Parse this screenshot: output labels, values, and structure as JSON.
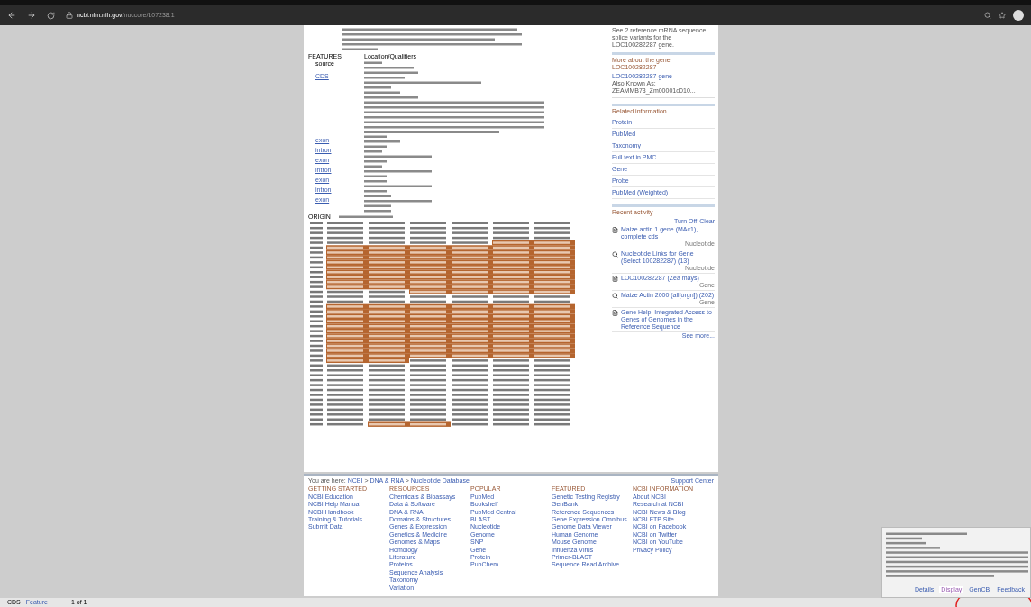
{
  "browser": {
    "url_host": "ncbi.nlm.nih.gov",
    "url_path": "/nuccore/L07238.1"
  },
  "record": {
    "features_label": "FEATURES",
    "location_label": "Location/Qualifiers",
    "origin_label": "ORIGIN",
    "feature_keys": [
      {
        "label": "source",
        "link": false
      },
      {
        "label": "CDS",
        "link": true
      },
      {
        "label": "exon",
        "link": true
      },
      {
        "label": "intron",
        "link": true
      },
      {
        "label": "exon",
        "link": true
      },
      {
        "label": "intron",
        "link": true
      },
      {
        "label": "exon",
        "link": true
      },
      {
        "label": "intron",
        "link": true
      },
      {
        "label": "exon",
        "link": true
      }
    ]
  },
  "sidebar": {
    "intro": "See 2 reference mRNA sequence splice variants for the LOC100282287 gene.",
    "more_about": {
      "title": "More about the gene LOC100282287",
      "link": "LOC100282287 gene",
      "lines": [
        "Also Known As:",
        "ZEAMMB73_Zm00001d010..."
      ]
    },
    "related": {
      "title": "Related information",
      "items": [
        "Protein",
        "PubMed",
        "Taxonomy",
        "Full text in PMC",
        "Gene",
        "Probe",
        "PubMed (Weighted)"
      ]
    },
    "recent": {
      "title": "Recent activity",
      "turn_off": "Turn Off",
      "clear": "Clear",
      "items": [
        {
          "kind": "record",
          "text": "Maize actin 1 gene (MAc1), complete cds",
          "db": "Nucleotide"
        },
        {
          "kind": "search",
          "text": "Nucleotide Links for Gene (Select 100282287) (13)",
          "db": "Nucleotide"
        },
        {
          "kind": "record",
          "text": "LOC100282287 (Zea mays)",
          "db": "Gene"
        },
        {
          "kind": "search",
          "text": "Maize Actin 2000 (all[orgn]) (202)",
          "db": "Gene"
        },
        {
          "kind": "record",
          "text": "Gene Help: Integrated Access to Genes of Genomes in the Reference Sequence"
        }
      ],
      "see_more": "See more..."
    }
  },
  "footer": {
    "you_are_here": "You are here:",
    "crumbs": [
      "NCBI",
      "DNA & RNA",
      "Nucleotide Database"
    ],
    "separator": ">",
    "support": "Support Center",
    "columns": [
      {
        "title": "GETTING STARTED",
        "links": [
          "NCBI Education",
          "NCBI Help Manual",
          "NCBI Handbook",
          "Training & Tutorials",
          "Submit Data"
        ]
      },
      {
        "title": "RESOURCES",
        "links": [
          "Chemicals & Bioassays",
          "Data & Software",
          "DNA & RNA",
          "Domains & Structures",
          "Genes & Expression",
          "Genetics & Medicine",
          "Genomes & Maps",
          "Homology",
          "Literature",
          "Proteins",
          "Sequence Analysis",
          "Taxonomy",
          "Variation"
        ]
      },
      {
        "title": "POPULAR",
        "links": [
          "PubMed",
          "Bookshelf",
          "PubMed Central",
          "BLAST",
          "Nucleotide",
          "Genome",
          "SNP",
          "Gene",
          "Protein",
          "PubChem"
        ]
      },
      {
        "title": "FEATURED",
        "links": [
          "Genetic Testing Registry",
          "GenBank",
          "Reference Sequences",
          "Gene Expression Omnibus",
          "Genome Data Viewer",
          "Human Genome",
          "Mouse Genome",
          "Influenza Virus",
          "Primer-BLAST",
          "Sequence Read Archive"
        ]
      },
      {
        "title": "NCBI INFORMATION",
        "links": [
          "About NCBI",
          "Research at NCBI",
          "NCBI News & Blog",
          "NCBI FTP Site",
          "NCBI on Facebook",
          "NCBI on Twitter",
          "NCBI on YouTube",
          "Privacy Policy"
        ]
      }
    ]
  },
  "status_bar": {
    "feature_type": "CDS",
    "feature_link": "Feature",
    "position": "1 of 1"
  },
  "popup": {
    "tabs": [
      {
        "label": "Details",
        "selected": false
      },
      {
        "label": "Display",
        "selected": true
      },
      {
        "label": "GenCB",
        "selected": false
      },
      {
        "label": "Feedback",
        "selected": false
      }
    ]
  }
}
